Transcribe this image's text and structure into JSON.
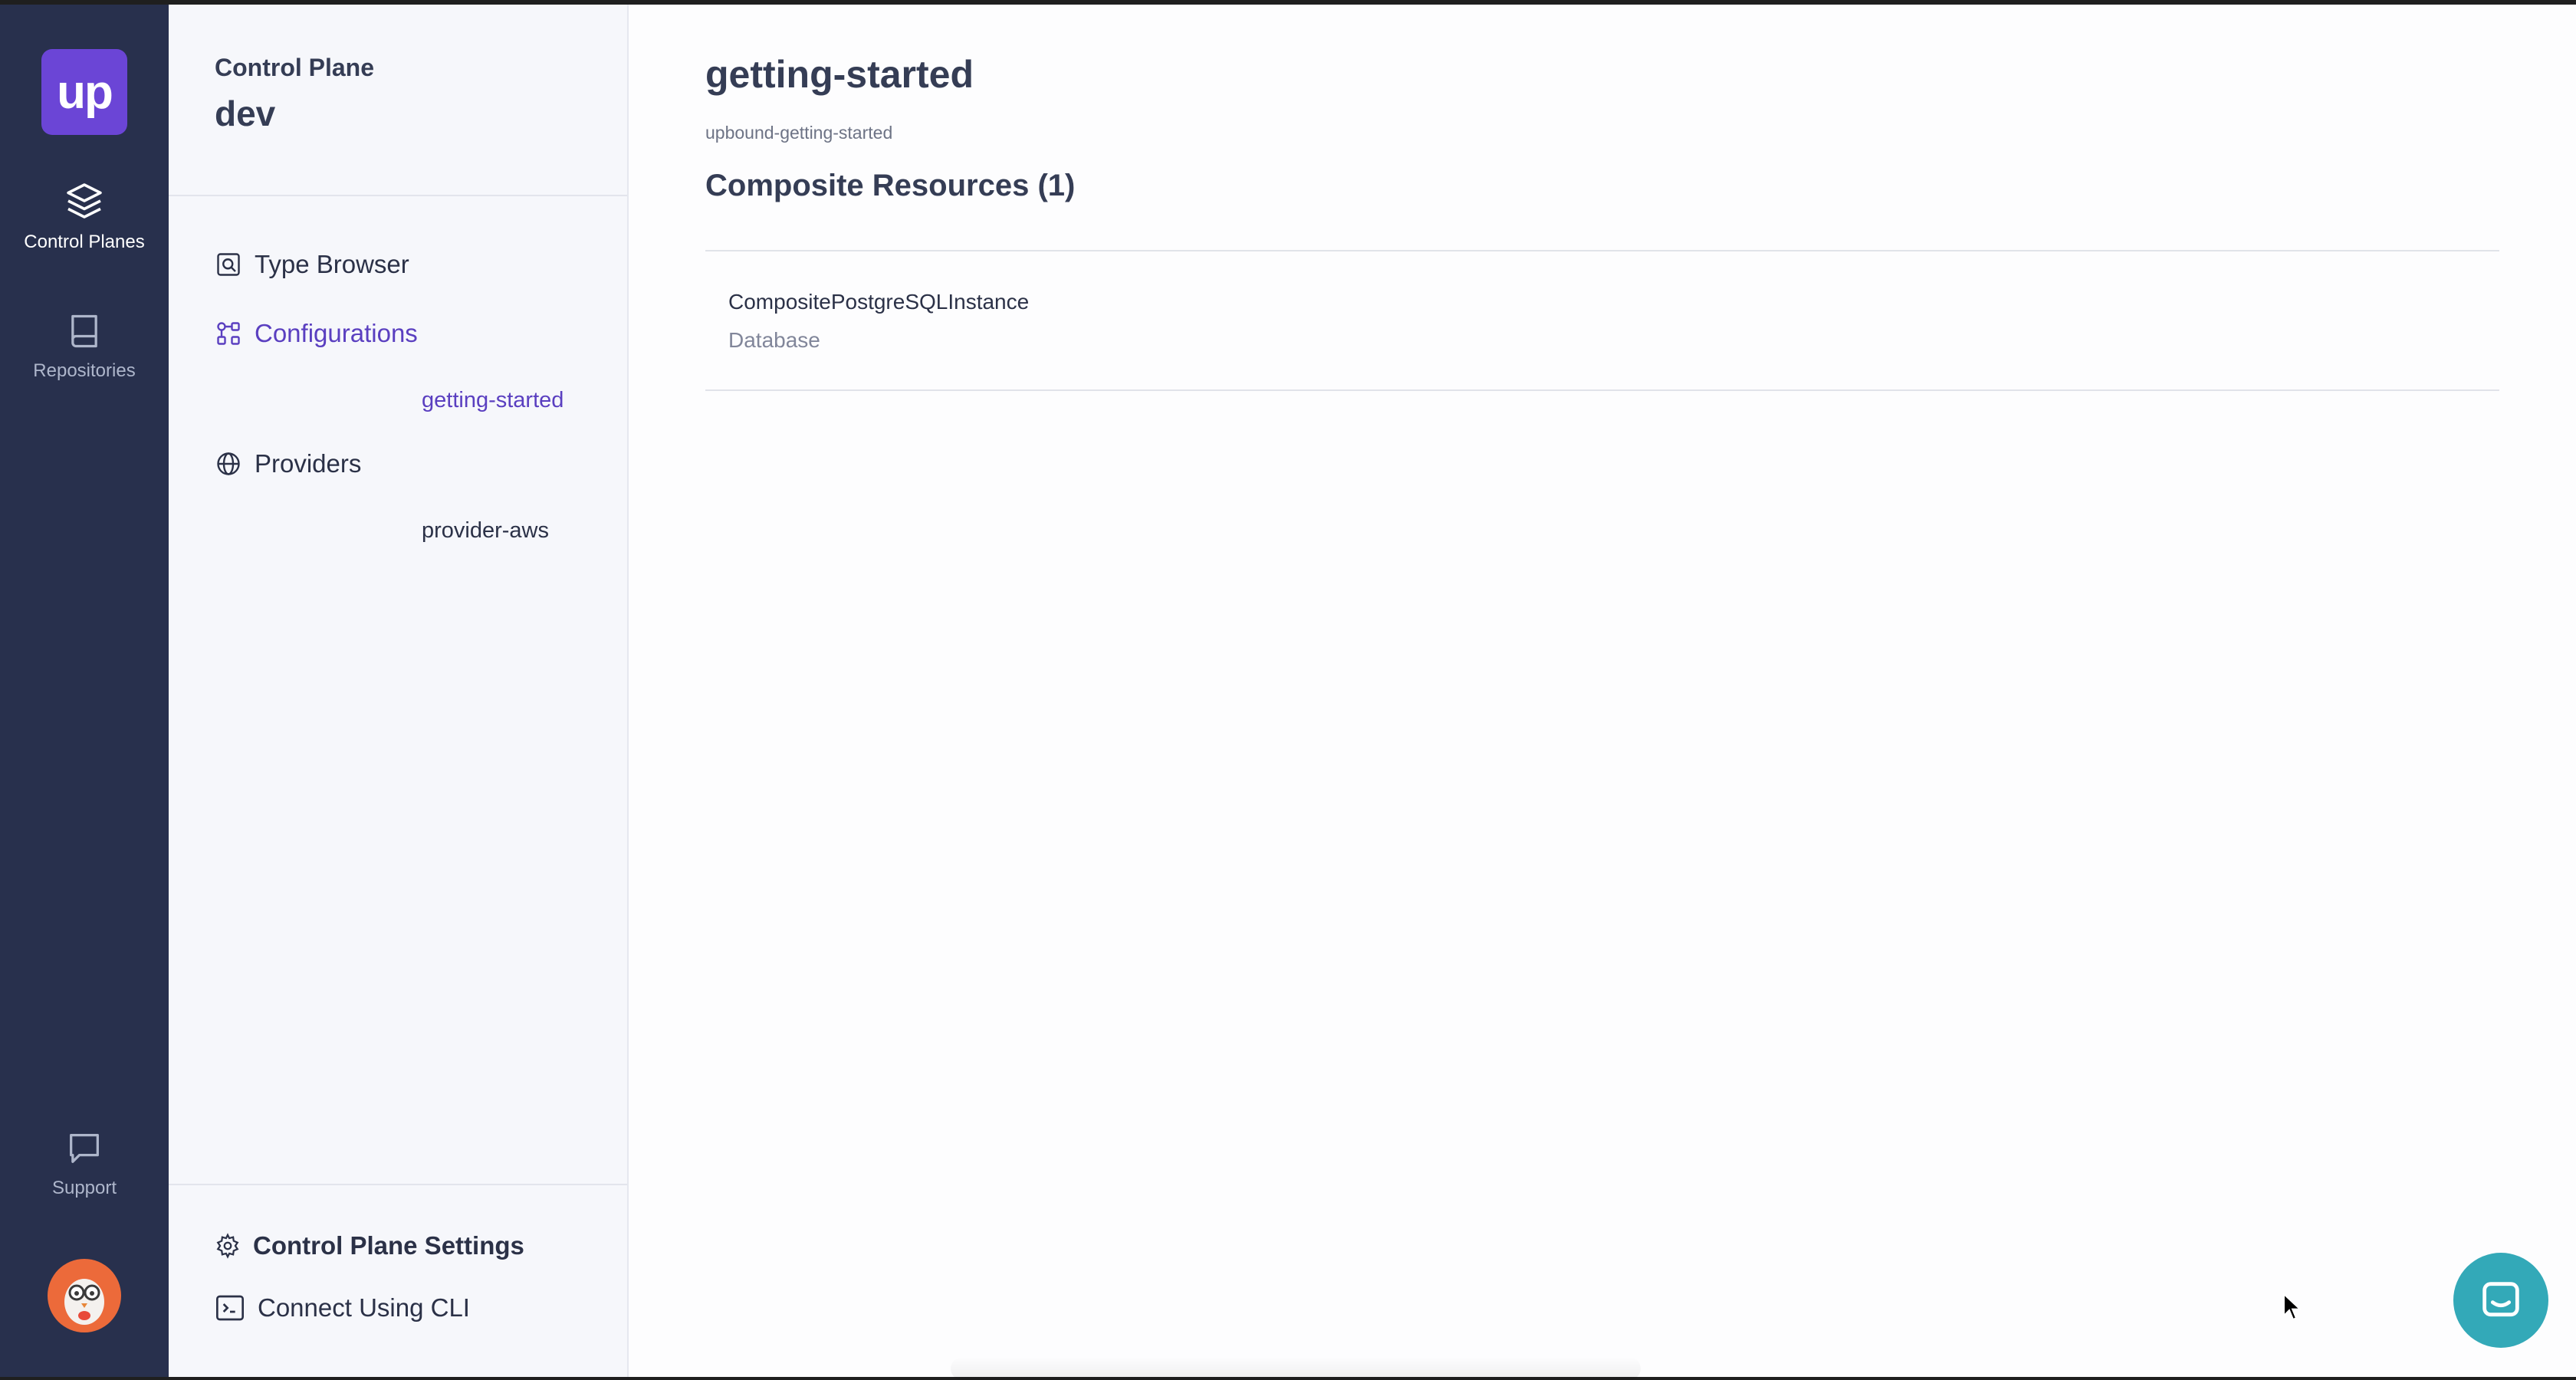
{
  "rail": {
    "logo_text": "up",
    "items": [
      {
        "label": "Control Planes",
        "icon": "layers-icon"
      },
      {
        "label": "Repositories",
        "icon": "book-icon"
      },
      {
        "label": "Support",
        "icon": "chat-bubble-icon"
      }
    ]
  },
  "sidebar": {
    "header_label": "Control Plane",
    "control_plane_name": "dev",
    "nav": [
      {
        "label": "Type Browser",
        "icon": "type-browser-icon"
      },
      {
        "label": "Configurations",
        "icon": "configurations-icon",
        "children": [
          "getting-started"
        ]
      },
      {
        "label": "Providers",
        "icon": "globe-icon",
        "children": [
          "provider-aws"
        ]
      }
    ],
    "footer": [
      {
        "label": "Control Plane Settings",
        "icon": "gear-icon"
      },
      {
        "label": "Connect Using CLI",
        "icon": "terminal-icon"
      }
    ]
  },
  "main": {
    "title": "getting-started",
    "subtitle": "upbound-getting-started",
    "section_title": "Composite Resources (1)",
    "resources": [
      {
        "name": "CompositePostgreSQLInstance",
        "type": "Database"
      }
    ]
  },
  "colors": {
    "rail_bg": "#28304d",
    "accent": "#5a3fc0",
    "logo_bg": "#6b45d6",
    "chat_button": "#33a9b8"
  }
}
